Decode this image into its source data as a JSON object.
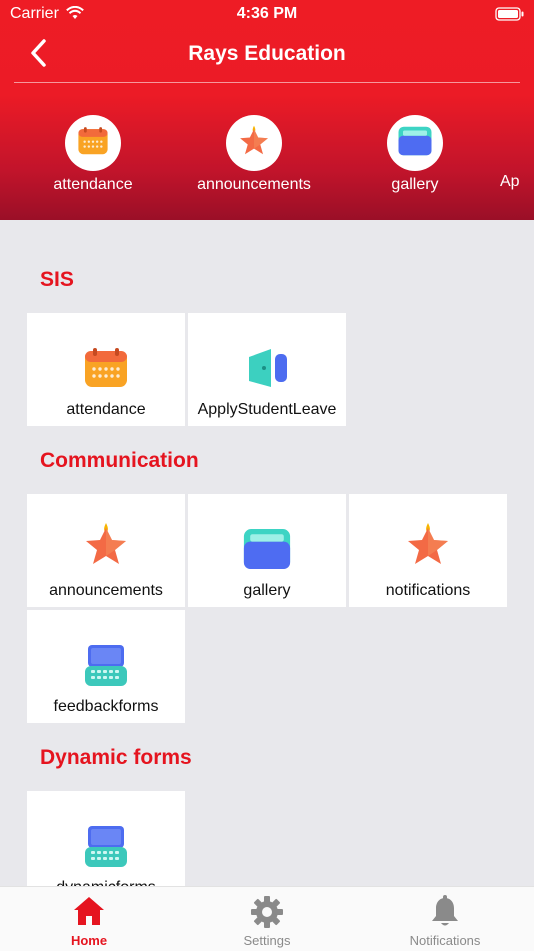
{
  "status_bar": {
    "carrier": "Carrier",
    "time": "4:36 PM"
  },
  "nav": {
    "title": "Rays Education"
  },
  "quick_access": [
    {
      "label": "attendance",
      "icon": "calendar-icon"
    },
    {
      "label": "announcements",
      "icon": "star-icon"
    },
    {
      "label": "gallery",
      "icon": "gallery-icon"
    },
    {
      "label": "Ap",
      "icon": ""
    }
  ],
  "sections": [
    {
      "title": "SIS",
      "items": [
        {
          "label": "attendance",
          "icon": "calendar-icon"
        },
        {
          "label": "ApplyStudentLeave",
          "icon": "door-icon"
        }
      ]
    },
    {
      "title": "Communication",
      "items": [
        {
          "label": "announcements",
          "icon": "star-icon"
        },
        {
          "label": "gallery",
          "icon": "gallery-icon"
        },
        {
          "label": "notifications",
          "icon": "star-icon"
        },
        {
          "label": "feedbackforms",
          "icon": "keyboard-icon"
        }
      ]
    },
    {
      "title": "Dynamic forms",
      "items": [
        {
          "label": "dynamicforms",
          "icon": "keyboard-icon"
        }
      ]
    }
  ],
  "tabs": [
    {
      "label": "Home",
      "icon": "home-icon",
      "active": true
    },
    {
      "label": "Settings",
      "icon": "gear-icon",
      "active": false
    },
    {
      "label": "Notifications",
      "icon": "bell-icon",
      "active": false
    }
  ],
  "colors": {
    "brand": "#ee1c25",
    "brand_dark": "#9a0f27",
    "tab_inactive": "#8a8a8a"
  }
}
